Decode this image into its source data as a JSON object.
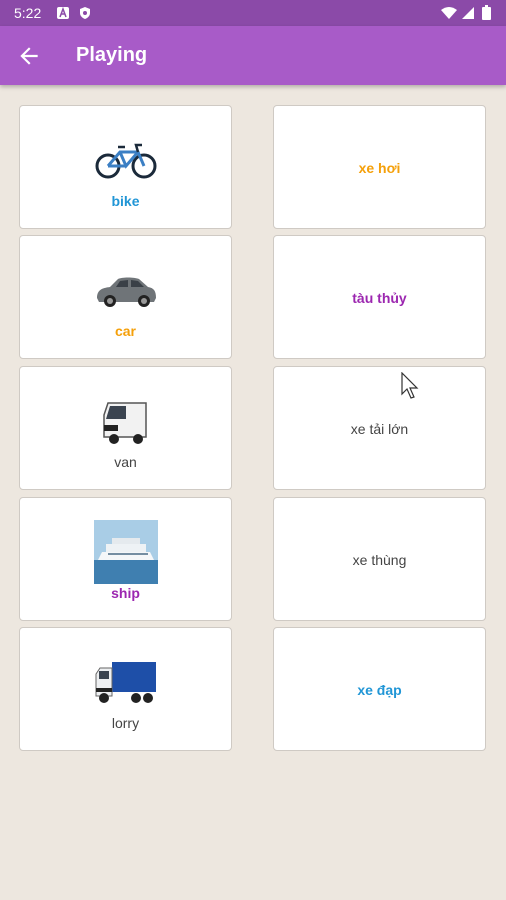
{
  "status_bar": {
    "time": "5:22",
    "icons": [
      "a-icon",
      "shield-icon",
      "wifi-icon",
      "signal-icon",
      "battery-icon"
    ]
  },
  "app_bar": {
    "title": "Playing",
    "back_icon": "arrow-left-icon"
  },
  "colors": {
    "app_bar": "#a85bc8",
    "status_bar": "#8b4aa8",
    "background": "#ede7df",
    "blue": "#2196d6",
    "orange": "#f5a00a",
    "purple": "#9c27b0",
    "gray": "#444444"
  },
  "left_cards": [
    {
      "label": "bike",
      "image": "bicycle-image",
      "color": "#2196d6",
      "bold": true
    },
    {
      "label": "car",
      "image": "car-image",
      "color": "#f5a00a",
      "bold": true
    },
    {
      "label": "van",
      "image": "van-image",
      "color": "#444444",
      "bold": false
    },
    {
      "label": "ship",
      "image": "cruise-ship-image",
      "color": "#9c27b0",
      "bold": true
    },
    {
      "label": "lorry",
      "image": "lorry-image",
      "color": "#444444",
      "bold": false
    }
  ],
  "right_cards": [
    {
      "label": "xe hơi",
      "color": "#f5a00a",
      "bold": true
    },
    {
      "label": "tàu thủy",
      "color": "#9c27b0",
      "bold": true
    },
    {
      "label": "xe tải lớn",
      "color": "#444444",
      "bold": false
    },
    {
      "label": "xe thùng",
      "color": "#444444",
      "bold": false
    },
    {
      "label": "xe đạp",
      "color": "#2196d6",
      "bold": true
    }
  ]
}
